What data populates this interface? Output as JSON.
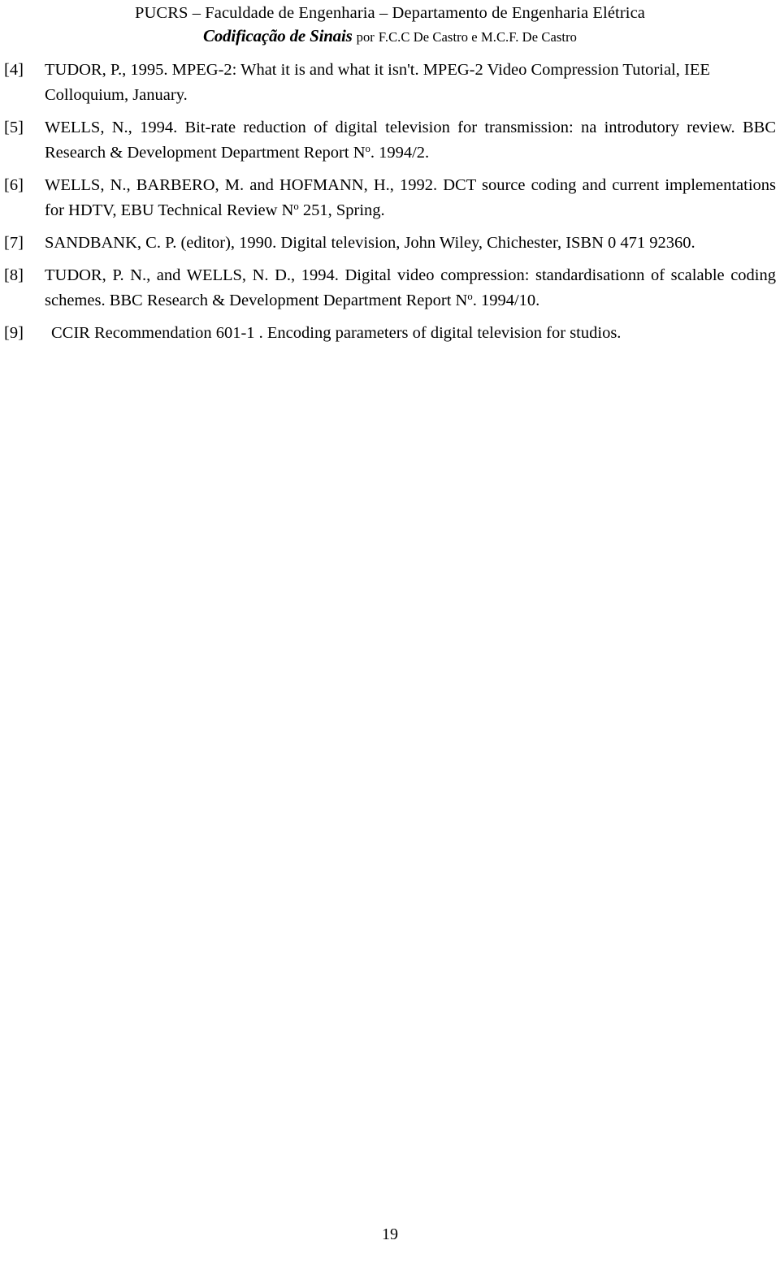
{
  "header": {
    "institution_line": "PUCRS – Faculdade de Engenharia – Departamento de Engenharia Elétrica",
    "course_title": "Codificação de Sinais",
    "by_word": "por",
    "authors": "F.C.C De Castro e M.C.F. De Castro"
  },
  "references": [
    {
      "label": "[4]",
      "text_before": "TUDOR, P., 1995. MPEG-2: What it is and what it isn't. MPEG-2 Video Compression Tutorial, IEE Colloquium, January.",
      "justified": false,
      "extra_indent": false
    },
    {
      "label": "[5]",
      "text_before": "WELLS, N., 1994. Bit-rate reduction of digital television for transmission: na introdutory review. BBC Research & Development Department Report N",
      "superscript": "o",
      "text_after": ". 1994/2.",
      "justified": true,
      "extra_indent": false
    },
    {
      "label": "[6]",
      "text_before": "WELLS, N., BARBERO, M. and HOFMANN, H., 1992. DCT source coding and current implementations for HDTV, EBU Technical Review N",
      "superscript": "o",
      "text_after": " 251, Spring.",
      "justified": true,
      "extra_indent": false
    },
    {
      "label": "[7]",
      "text_before": "SANDBANK, C. P. (editor), 1990. Digital television, John Wiley, Chichester, ISBN 0 471 92360.",
      "justified": false,
      "extra_indent": false
    },
    {
      "label": "[8]",
      "text_before": "TUDOR, P. N., and WELLS, N. D., 1994. Digital video compression: standardisationn of scalable coding schemes. BBC Research & Development Department Report N",
      "superscript": "o",
      "text_after": ". 1994/10.",
      "justified": true,
      "extra_indent": false
    },
    {
      "label": "[9]",
      "text_before": "CCIR Recommendation 601-1 . Encoding parameters of digital television for studios.",
      "justified": false,
      "extra_indent": true
    }
  ],
  "footer": {
    "page_number": "19"
  }
}
